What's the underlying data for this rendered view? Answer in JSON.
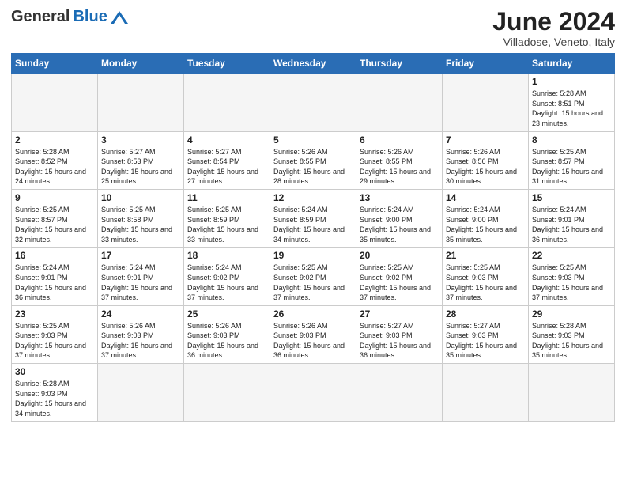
{
  "logo": {
    "general": "General",
    "blue": "Blue"
  },
  "title": "June 2024",
  "subtitle": "Villadose, Veneto, Italy",
  "days_of_week": [
    "Sunday",
    "Monday",
    "Tuesday",
    "Wednesday",
    "Thursday",
    "Friday",
    "Saturday"
  ],
  "weeks": [
    [
      {
        "day": null,
        "info": ""
      },
      {
        "day": null,
        "info": ""
      },
      {
        "day": null,
        "info": ""
      },
      {
        "day": null,
        "info": ""
      },
      {
        "day": null,
        "info": ""
      },
      {
        "day": null,
        "info": ""
      },
      {
        "day": "1",
        "info": "Sunrise: 5:28 AM\nSunset: 8:51 PM\nDaylight: 15 hours\nand 23 minutes."
      }
    ],
    [
      {
        "day": "2",
        "info": "Sunrise: 5:28 AM\nSunset: 8:52 PM\nDaylight: 15 hours\nand 24 minutes."
      },
      {
        "day": "3",
        "info": "Sunrise: 5:27 AM\nSunset: 8:53 PM\nDaylight: 15 hours\nand 25 minutes."
      },
      {
        "day": "4",
        "info": "Sunrise: 5:27 AM\nSunset: 8:54 PM\nDaylight: 15 hours\nand 27 minutes."
      },
      {
        "day": "5",
        "info": "Sunrise: 5:26 AM\nSunset: 8:55 PM\nDaylight: 15 hours\nand 28 minutes."
      },
      {
        "day": "6",
        "info": "Sunrise: 5:26 AM\nSunset: 8:55 PM\nDaylight: 15 hours\nand 29 minutes."
      },
      {
        "day": "7",
        "info": "Sunrise: 5:26 AM\nSunset: 8:56 PM\nDaylight: 15 hours\nand 30 minutes."
      },
      {
        "day": "8",
        "info": "Sunrise: 5:25 AM\nSunset: 8:57 PM\nDaylight: 15 hours\nand 31 minutes."
      }
    ],
    [
      {
        "day": "9",
        "info": "Sunrise: 5:25 AM\nSunset: 8:57 PM\nDaylight: 15 hours\nand 32 minutes."
      },
      {
        "day": "10",
        "info": "Sunrise: 5:25 AM\nSunset: 8:58 PM\nDaylight: 15 hours\nand 33 minutes."
      },
      {
        "day": "11",
        "info": "Sunrise: 5:25 AM\nSunset: 8:59 PM\nDaylight: 15 hours\nand 33 minutes."
      },
      {
        "day": "12",
        "info": "Sunrise: 5:24 AM\nSunset: 8:59 PM\nDaylight: 15 hours\nand 34 minutes."
      },
      {
        "day": "13",
        "info": "Sunrise: 5:24 AM\nSunset: 9:00 PM\nDaylight: 15 hours\nand 35 minutes."
      },
      {
        "day": "14",
        "info": "Sunrise: 5:24 AM\nSunset: 9:00 PM\nDaylight: 15 hours\nand 35 minutes."
      },
      {
        "day": "15",
        "info": "Sunrise: 5:24 AM\nSunset: 9:01 PM\nDaylight: 15 hours\nand 36 minutes."
      }
    ],
    [
      {
        "day": "16",
        "info": "Sunrise: 5:24 AM\nSunset: 9:01 PM\nDaylight: 15 hours\nand 36 minutes."
      },
      {
        "day": "17",
        "info": "Sunrise: 5:24 AM\nSunset: 9:01 PM\nDaylight: 15 hours\nand 37 minutes."
      },
      {
        "day": "18",
        "info": "Sunrise: 5:24 AM\nSunset: 9:02 PM\nDaylight: 15 hours\nand 37 minutes."
      },
      {
        "day": "19",
        "info": "Sunrise: 5:25 AM\nSunset: 9:02 PM\nDaylight: 15 hours\nand 37 minutes."
      },
      {
        "day": "20",
        "info": "Sunrise: 5:25 AM\nSunset: 9:02 PM\nDaylight: 15 hours\nand 37 minutes."
      },
      {
        "day": "21",
        "info": "Sunrise: 5:25 AM\nSunset: 9:03 PM\nDaylight: 15 hours\nand 37 minutes."
      },
      {
        "day": "22",
        "info": "Sunrise: 5:25 AM\nSunset: 9:03 PM\nDaylight: 15 hours\nand 37 minutes."
      }
    ],
    [
      {
        "day": "23",
        "info": "Sunrise: 5:25 AM\nSunset: 9:03 PM\nDaylight: 15 hours\nand 37 minutes."
      },
      {
        "day": "24",
        "info": "Sunrise: 5:26 AM\nSunset: 9:03 PM\nDaylight: 15 hours\nand 37 minutes."
      },
      {
        "day": "25",
        "info": "Sunrise: 5:26 AM\nSunset: 9:03 PM\nDaylight: 15 hours\nand 36 minutes."
      },
      {
        "day": "26",
        "info": "Sunrise: 5:26 AM\nSunset: 9:03 PM\nDaylight: 15 hours\nand 36 minutes."
      },
      {
        "day": "27",
        "info": "Sunrise: 5:27 AM\nSunset: 9:03 PM\nDaylight: 15 hours\nand 36 minutes."
      },
      {
        "day": "28",
        "info": "Sunrise: 5:27 AM\nSunset: 9:03 PM\nDaylight: 15 hours\nand 35 minutes."
      },
      {
        "day": "29",
        "info": "Sunrise: 5:28 AM\nSunset: 9:03 PM\nDaylight: 15 hours\nand 35 minutes."
      }
    ],
    [
      {
        "day": "30",
        "info": "Sunrise: 5:28 AM\nSunset: 9:03 PM\nDaylight: 15 hours\nand 34 minutes."
      },
      {
        "day": null,
        "info": ""
      },
      {
        "day": null,
        "info": ""
      },
      {
        "day": null,
        "info": ""
      },
      {
        "day": null,
        "info": ""
      },
      {
        "day": null,
        "info": ""
      },
      {
        "day": null,
        "info": ""
      }
    ]
  ]
}
